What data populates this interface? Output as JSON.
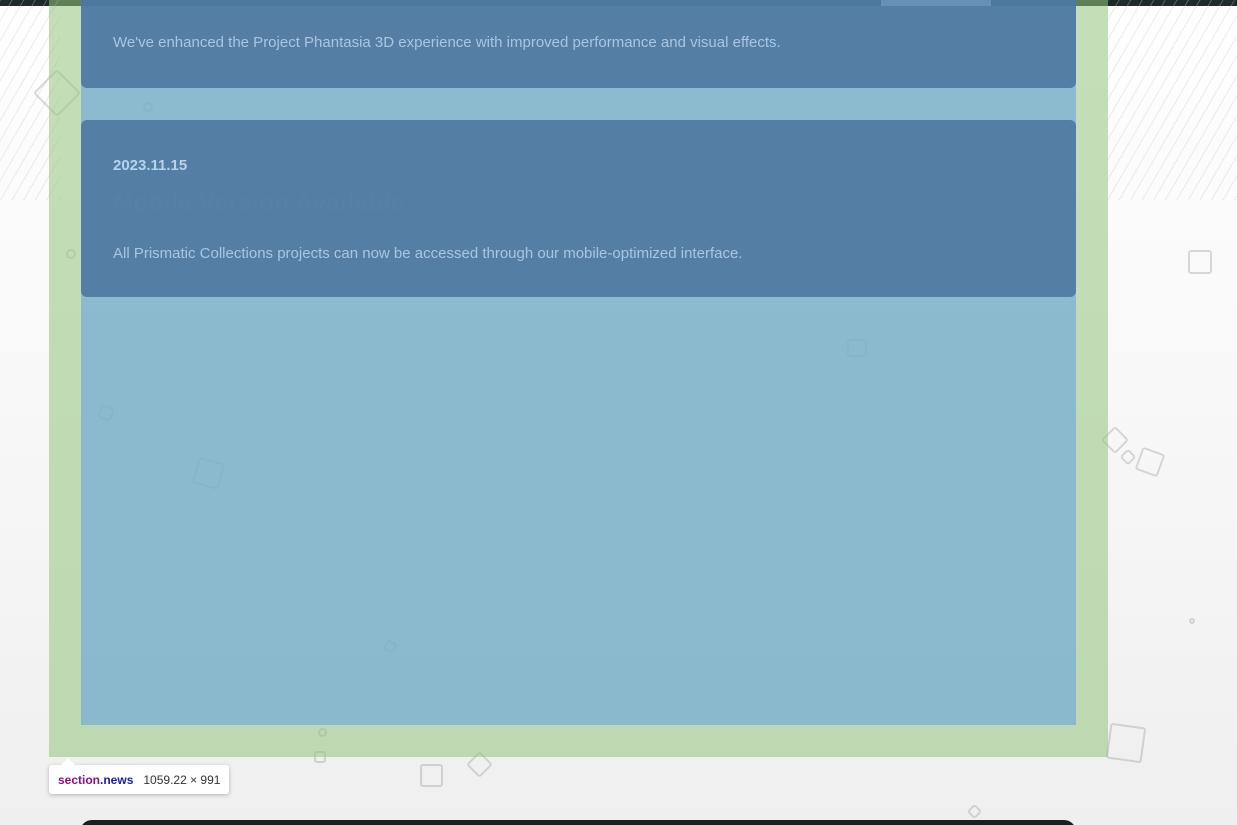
{
  "news": {
    "items": [
      {
        "date": "",
        "title": "",
        "text": "We've enhanced the Project Phantasia 3D experience with improved performance and visual effects."
      },
      {
        "date": "2023.11.15",
        "title": "Mobile Version Available",
        "text": "All Prismatic Collections projects can now be accessed through our mobile-optimized interface."
      }
    ]
  },
  "inspector": {
    "tag": "section",
    "class": ".news",
    "dimensions": "1059.22 × 991"
  },
  "colors": {
    "margin_highlight": "#93c47d",
    "content_highlight": "#6fa8dc",
    "card_background": "#4a739b"
  }
}
